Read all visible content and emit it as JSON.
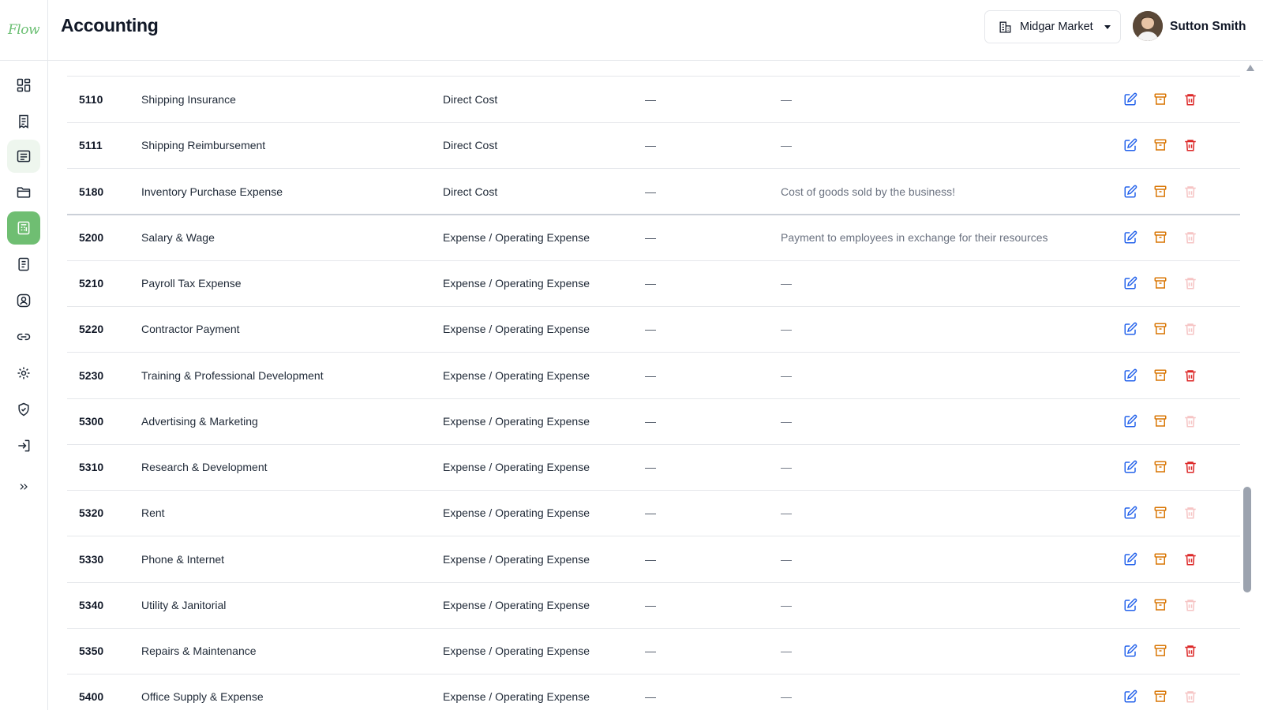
{
  "app": {
    "logo": "Flow",
    "title": "Accounting"
  },
  "header": {
    "store": "Midgar Market",
    "user_name": "Sutton Smith"
  },
  "sidebar": {
    "items": [
      {
        "name": "dashboard-icon"
      },
      {
        "name": "receipt-icon"
      },
      {
        "name": "document-list-icon"
      },
      {
        "name": "folder-icon"
      },
      {
        "name": "accounting-icon"
      },
      {
        "name": "report-icon"
      },
      {
        "name": "user-circle-icon"
      },
      {
        "name": "link-icon"
      },
      {
        "name": "gear-icon"
      },
      {
        "name": "shield-icon"
      },
      {
        "name": "login-icon"
      },
      {
        "name": "expand-icon"
      }
    ]
  },
  "table": {
    "rows": [
      {
        "code": "5110",
        "name": "Shipping Insurance",
        "type": "Direct Cost",
        "col4": "—",
        "desc": "—",
        "delete_enabled": true
      },
      {
        "code": "5111",
        "name": "Shipping Reimbursement",
        "type": "Direct Cost",
        "col4": "—",
        "desc": "—",
        "delete_enabled": true
      },
      {
        "code": "5180",
        "name": "Inventory Purchase Expense",
        "type": "Direct Cost",
        "col4": "—",
        "desc": "Cost of goods sold by the business!",
        "delete_enabled": false
      },
      {
        "code": "5200",
        "name": "Salary & Wage",
        "type": "Expense / Operating Expense",
        "col4": "—",
        "desc": "Payment to employees in exchange for their resources",
        "delete_enabled": false
      },
      {
        "code": "5210",
        "name": "Payroll Tax Expense",
        "type": "Expense / Operating Expense",
        "col4": "—",
        "desc": "—",
        "delete_enabled": false
      },
      {
        "code": "5220",
        "name": "Contractor Payment",
        "type": "Expense / Operating Expense",
        "col4": "—",
        "desc": "—",
        "delete_enabled": false
      },
      {
        "code": "5230",
        "name": "Training & Professional Development",
        "type": "Expense / Operating Expense",
        "col4": "—",
        "desc": "—",
        "delete_enabled": true
      },
      {
        "code": "5300",
        "name": "Advertising & Marketing",
        "type": "Expense / Operating Expense",
        "col4": "—",
        "desc": "—",
        "delete_enabled": false
      },
      {
        "code": "5310",
        "name": "Research & Development",
        "type": "Expense / Operating Expense",
        "col4": "—",
        "desc": "—",
        "delete_enabled": true
      },
      {
        "code": "5320",
        "name": "Rent",
        "type": "Expense / Operating Expense",
        "col4": "—",
        "desc": "—",
        "delete_enabled": false
      },
      {
        "code": "5330",
        "name": "Phone & Internet",
        "type": "Expense / Operating Expense",
        "col4": "—",
        "desc": "—",
        "delete_enabled": true
      },
      {
        "code": "5340",
        "name": "Utility & Janitorial",
        "type": "Expense / Operating Expense",
        "col4": "—",
        "desc": "—",
        "delete_enabled": false
      },
      {
        "code": "5350",
        "name": "Repairs & Maintenance",
        "type": "Expense / Operating Expense",
        "col4": "—",
        "desc": "—",
        "delete_enabled": true
      },
      {
        "code": "5400",
        "name": "Office Supply & Expense",
        "type": "Expense / Operating Expense",
        "col4": "—",
        "desc": "—",
        "delete_enabled": false
      }
    ]
  },
  "colors": {
    "brand": "#6fbe72",
    "edit": "#2563eb",
    "archive": "#d97706",
    "delete": "#dc2626"
  }
}
